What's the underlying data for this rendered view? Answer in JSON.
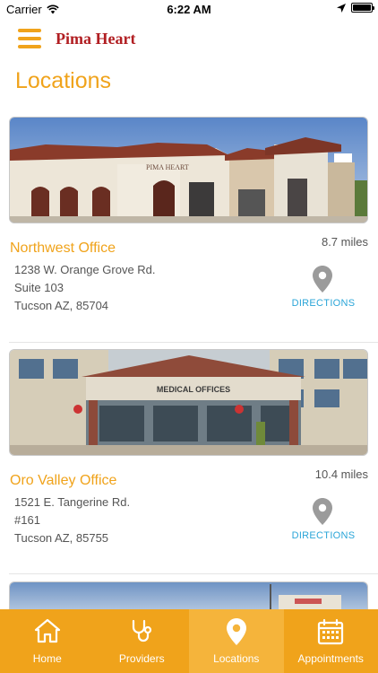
{
  "status_bar": {
    "carrier": "Carrier",
    "time": "6:22 AM"
  },
  "nav": {
    "app_title": "Pima Heart"
  },
  "page": {
    "title": "Locations"
  },
  "locations": [
    {
      "name": "Northwest Office",
      "distance": "8.7 miles",
      "address": [
        "1238 W. Orange Grove Rd.",
        "Suite 103",
        "Tucson AZ, 85704"
      ],
      "directions_label": "DIRECTIONS",
      "sign_text": "PIMA HEART"
    },
    {
      "name": "Oro Valley Office",
      "distance": "10.4 miles",
      "address": [
        "1521 E. Tangerine Rd.",
        "#161",
        "Tucson AZ, 85755"
      ],
      "directions_label": "DIRECTIONS",
      "sign_text": "MEDICAL OFFICES"
    }
  ],
  "tabs": [
    {
      "label": "Home",
      "icon": "home-icon"
    },
    {
      "label": "Providers",
      "icon": "stethoscope-icon"
    },
    {
      "label": "Locations",
      "icon": "map-pin-icon",
      "active": true
    },
    {
      "label": "Appointments",
      "icon": "calendar-icon"
    }
  ],
  "colors": {
    "accent": "#f0a31b",
    "brand": "#b11e22",
    "link": "#2aa5d8"
  }
}
